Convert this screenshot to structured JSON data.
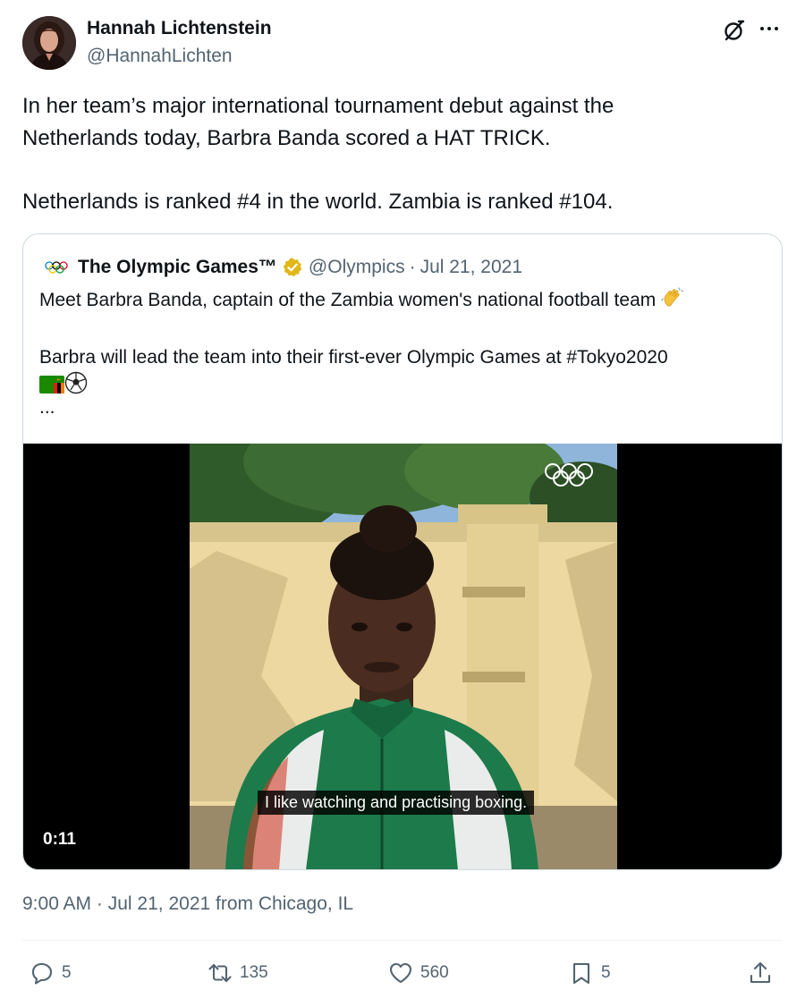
{
  "author": {
    "name": "Hannah Lichtenstein",
    "handle": "@HannahLichten"
  },
  "tweet": {
    "lines": [
      "In her team’s major international tournament debut against the",
      "Netherlands today, Barbra Banda scored a HAT TRICK.",
      "Netherlands is ranked #4 in the world. Zambia is ranked #104."
    ]
  },
  "quote": {
    "name": "The Olympic Games™",
    "handle": "@Olympics",
    "separator": "·",
    "date": "Jul 21, 2021",
    "line1": "Meet Barbra Banda, captain of the Zambia women's national football team",
    "line2": "Barbra will lead the team into their first-ever Olympic Games at #Tokyo2020",
    "ellipsis": "...",
    "video": {
      "subtitle": "I like watching and practising boxing.",
      "duration": "0:11"
    }
  },
  "timestamp": {
    "time": "9:00 AM",
    "separator": "·",
    "date": "Jul 21, 2021",
    "from_text": "from Chicago, IL"
  },
  "actions": {
    "replies": "5",
    "reposts": "135",
    "likes": "560",
    "bookmarks": "5"
  },
  "icons": {
    "grok": "grok-icon",
    "more": "more-icon",
    "verified": "verified-badge-icon",
    "reply": "reply-icon",
    "repost": "repost-icon",
    "like": "heart-icon",
    "bookmark": "bookmark-icon",
    "share": "share-icon"
  },
  "colors": {
    "text": "#0f1419",
    "secondary": "#536471",
    "border": "#cfd9de",
    "verified_gold": "#e2b719"
  }
}
